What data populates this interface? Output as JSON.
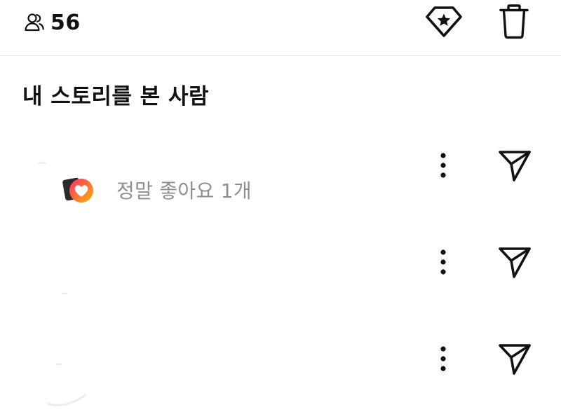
{
  "header": {
    "viewer_icon": "people-icon",
    "viewer_count": "56",
    "highlight_icon": "highlight-star-icon",
    "delete_icon": "trash-icon"
  },
  "section": {
    "title": "내 스토리를 본 사람"
  },
  "viewers": [
    {
      "reaction_icon": "love-reaction-icon",
      "reaction_text": "정말 좋아요 1개",
      "more_icon": "more-vertical-icon",
      "send_icon": "send-icon"
    },
    {
      "more_icon": "more-vertical-icon",
      "send_icon": "send-icon"
    },
    {
      "more_icon": "more-vertical-icon",
      "send_icon": "send-icon"
    }
  ],
  "colors": {
    "text_primary": "#111111",
    "text_secondary": "#8e8e8e",
    "divider": "#e3e3e3",
    "reaction_gradient_start": "#ff2d6f",
    "reaction_gradient_end": "#ffb300"
  }
}
